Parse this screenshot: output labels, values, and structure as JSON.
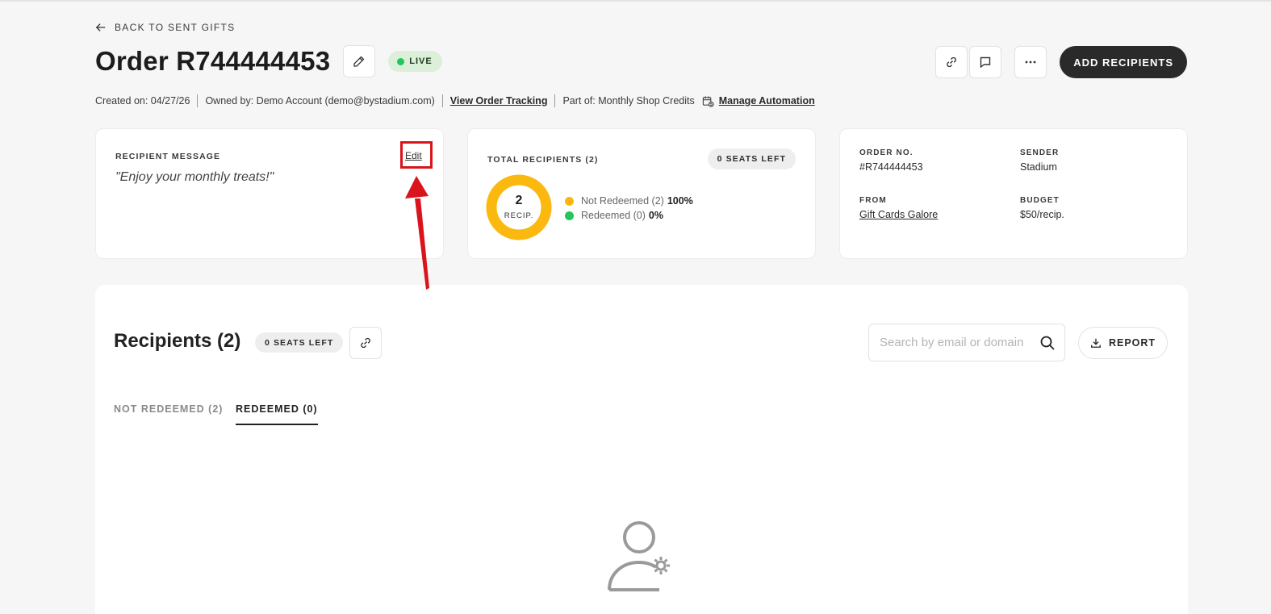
{
  "nav": {
    "back_label": "BACK TO SENT GIFTS"
  },
  "header": {
    "title": "Order R744444453",
    "status": "LIVE",
    "add_recipients_label": "ADD RECIPIENTS"
  },
  "meta": {
    "created": "Created on: 04/27/26",
    "owned_by": "Owned by: Demo Account (demo@bystadium.com)",
    "view_tracking": "View Order Tracking",
    "part_of": "Part of: Monthly Shop Credits",
    "manage_automation": "Manage Automation"
  },
  "message_card": {
    "label": "RECIPIENT MESSAGE",
    "message": "\"Enjoy your monthly treats!\"",
    "edit_label": "Edit"
  },
  "recipients_card": {
    "label": "TOTAL RECIPIENTS (2)",
    "seats_left": "0 SEATS LEFT",
    "donut_count": "2",
    "donut_sub": "RECIP.",
    "legend": [
      {
        "label": "Not Redeemed (2)",
        "pct": "100%",
        "color": "#fbb80f"
      },
      {
        "label": "Redeemed (0)",
        "pct": "0%",
        "color": "#22c55e"
      }
    ],
    "redeemed_fraction": 0
  },
  "order_card": {
    "order_no_label": "ORDER NO.",
    "order_no": "#R744444453",
    "sender_label": "SENDER",
    "sender": "Stadium",
    "from_label": "FROM",
    "from": "Gift Cards Galore",
    "budget_label": "BUDGET",
    "budget": "$50/recip."
  },
  "recipients_panel": {
    "title": "Recipients (2)",
    "seats_left": "0 SEATS LEFT",
    "search_placeholder": "Search by email or domain",
    "report_label": "REPORT",
    "tabs": [
      {
        "label": "NOT REDEEMED (2)",
        "active": false
      },
      {
        "label": "REDEEMED (0)",
        "active": true
      }
    ]
  },
  "colors": {
    "accent_dark": "#2a2a2a",
    "live_bg": "#dcefd8",
    "live_dot": "#22c55e",
    "annotation_red": "#d9141c"
  }
}
